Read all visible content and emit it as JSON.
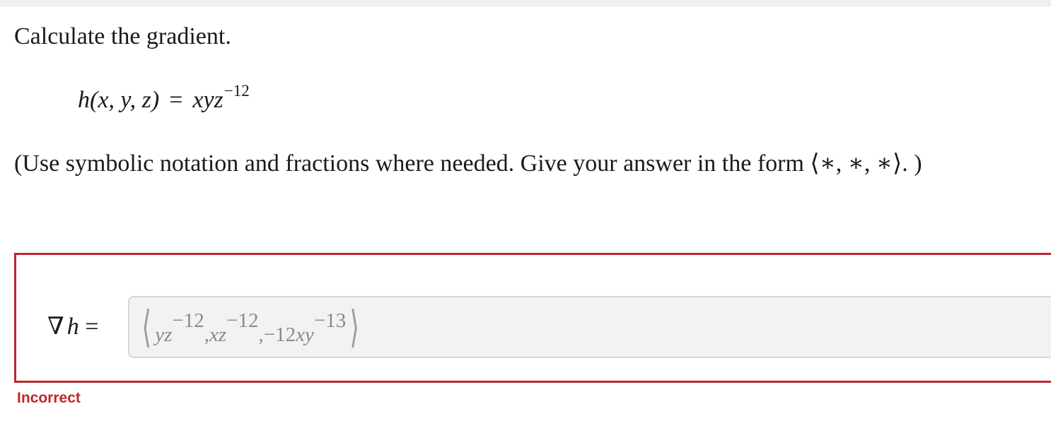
{
  "question": {
    "prompt": "Calculate the gradient.",
    "equation": {
      "func": "h",
      "args": "(x, y, z)",
      "equals": "=",
      "rhs": "xyz",
      "exponent": "−12"
    },
    "instruction": "(Use symbolic notation and fractions where needed. Give your answer in the form ⟨∗, ∗, ∗⟩. )"
  },
  "answer": {
    "label_nabla": "∇",
    "label_var": "h",
    "label_equals": "=",
    "open_bracket": "⟨",
    "close_bracket": "⟩",
    "comp1_base": "yz",
    "comp1_exp": "−12",
    "sep1": ",",
    "comp2_base": "xz",
    "comp2_exp": "−12",
    "sep2": ",",
    "comp3_coef": "−12",
    "comp3_base": "xy",
    "comp3_exp": "−13"
  },
  "status": {
    "text": "Incorrect",
    "color": "#c0252e"
  }
}
